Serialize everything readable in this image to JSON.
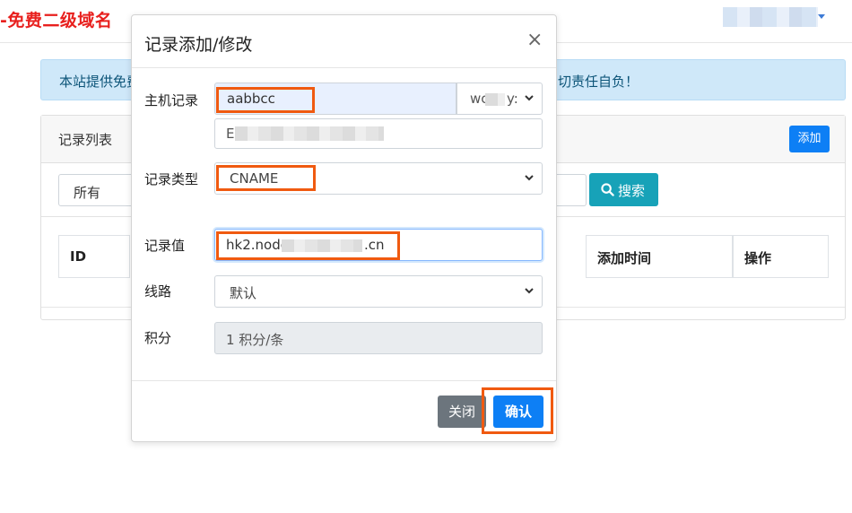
{
  "navbar": {
    "brand": "-免费二级域名",
    "user_menu_icon": "caret-down-icon"
  },
  "notice": {
    "text_left": "本站提供免费",
    "text_right": "切责任自负！"
  },
  "record_list": {
    "title": "记录列表",
    "add_label": "添加",
    "filter_value": "所有",
    "search_label": "搜索",
    "columns": [
      "ID",
      "添加时间",
      "操作"
    ]
  },
  "modal": {
    "title": "记录添加/修改",
    "close_glyph": "×",
    "host_label": "主机记录",
    "host_value": "aabbcc",
    "domain_suffix_partial": "wc",
    "domain_suffix_tail": "y:",
    "type_label": "记录类型",
    "type_value": "CNAME",
    "value_label": "记录值",
    "value_prefix": "hk2.node",
    "value_suffix": ".cn",
    "line_label": "线路",
    "line_value": "默认",
    "points_label": "积分",
    "points_value": "1 积分/条",
    "cancel_label": "关闭",
    "confirm_label": "确认"
  },
  "colors": {
    "brand": "#e8201e",
    "primary": "#0d7ff5",
    "info": "#17a2b8",
    "secondary": "#6c757d",
    "highlight": "#f05a10",
    "alert_bg": "#cfe8f9"
  }
}
